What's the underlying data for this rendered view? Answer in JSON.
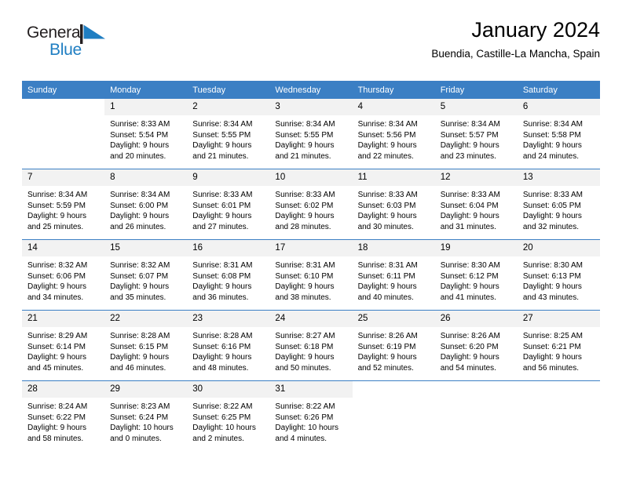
{
  "brand": {
    "name_part1": "General",
    "name_part2": "Blue",
    "flag_icon": "blue-triangle-flag-icon",
    "accent_color": "#1f7ec2"
  },
  "header": {
    "title": "January 2024",
    "subtitle": "Buendia, Castille-La Mancha, Spain"
  },
  "calendar": {
    "header_bg": "#3b7fc4",
    "daynum_bg": "#f2f2f2",
    "weekday_headers": [
      "Sunday",
      "Monday",
      "Tuesday",
      "Wednesday",
      "Thursday",
      "Friday",
      "Saturday"
    ],
    "weeks": [
      [
        {
          "day": "",
          "lines": []
        },
        {
          "day": "1",
          "lines": [
            "Sunrise: 8:33 AM",
            "Sunset: 5:54 PM",
            "Daylight: 9 hours",
            "and 20 minutes."
          ]
        },
        {
          "day": "2",
          "lines": [
            "Sunrise: 8:34 AM",
            "Sunset: 5:55 PM",
            "Daylight: 9 hours",
            "and 21 minutes."
          ]
        },
        {
          "day": "3",
          "lines": [
            "Sunrise: 8:34 AM",
            "Sunset: 5:55 PM",
            "Daylight: 9 hours",
            "and 21 minutes."
          ]
        },
        {
          "day": "4",
          "lines": [
            "Sunrise: 8:34 AM",
            "Sunset: 5:56 PM",
            "Daylight: 9 hours",
            "and 22 minutes."
          ]
        },
        {
          "day": "5",
          "lines": [
            "Sunrise: 8:34 AM",
            "Sunset: 5:57 PM",
            "Daylight: 9 hours",
            "and 23 minutes."
          ]
        },
        {
          "day": "6",
          "lines": [
            "Sunrise: 8:34 AM",
            "Sunset: 5:58 PM",
            "Daylight: 9 hours",
            "and 24 minutes."
          ]
        }
      ],
      [
        {
          "day": "7",
          "lines": [
            "Sunrise: 8:34 AM",
            "Sunset: 5:59 PM",
            "Daylight: 9 hours",
            "and 25 minutes."
          ]
        },
        {
          "day": "8",
          "lines": [
            "Sunrise: 8:34 AM",
            "Sunset: 6:00 PM",
            "Daylight: 9 hours",
            "and 26 minutes."
          ]
        },
        {
          "day": "9",
          "lines": [
            "Sunrise: 8:33 AM",
            "Sunset: 6:01 PM",
            "Daylight: 9 hours",
            "and 27 minutes."
          ]
        },
        {
          "day": "10",
          "lines": [
            "Sunrise: 8:33 AM",
            "Sunset: 6:02 PM",
            "Daylight: 9 hours",
            "and 28 minutes."
          ]
        },
        {
          "day": "11",
          "lines": [
            "Sunrise: 8:33 AM",
            "Sunset: 6:03 PM",
            "Daylight: 9 hours",
            "and 30 minutes."
          ]
        },
        {
          "day": "12",
          "lines": [
            "Sunrise: 8:33 AM",
            "Sunset: 6:04 PM",
            "Daylight: 9 hours",
            "and 31 minutes."
          ]
        },
        {
          "day": "13",
          "lines": [
            "Sunrise: 8:33 AM",
            "Sunset: 6:05 PM",
            "Daylight: 9 hours",
            "and 32 minutes."
          ]
        }
      ],
      [
        {
          "day": "14",
          "lines": [
            "Sunrise: 8:32 AM",
            "Sunset: 6:06 PM",
            "Daylight: 9 hours",
            "and 34 minutes."
          ]
        },
        {
          "day": "15",
          "lines": [
            "Sunrise: 8:32 AM",
            "Sunset: 6:07 PM",
            "Daylight: 9 hours",
            "and 35 minutes."
          ]
        },
        {
          "day": "16",
          "lines": [
            "Sunrise: 8:31 AM",
            "Sunset: 6:08 PM",
            "Daylight: 9 hours",
            "and 36 minutes."
          ]
        },
        {
          "day": "17",
          "lines": [
            "Sunrise: 8:31 AM",
            "Sunset: 6:10 PM",
            "Daylight: 9 hours",
            "and 38 minutes."
          ]
        },
        {
          "day": "18",
          "lines": [
            "Sunrise: 8:31 AM",
            "Sunset: 6:11 PM",
            "Daylight: 9 hours",
            "and 40 minutes."
          ]
        },
        {
          "day": "19",
          "lines": [
            "Sunrise: 8:30 AM",
            "Sunset: 6:12 PM",
            "Daylight: 9 hours",
            "and 41 minutes."
          ]
        },
        {
          "day": "20",
          "lines": [
            "Sunrise: 8:30 AM",
            "Sunset: 6:13 PM",
            "Daylight: 9 hours",
            "and 43 minutes."
          ]
        }
      ],
      [
        {
          "day": "21",
          "lines": [
            "Sunrise: 8:29 AM",
            "Sunset: 6:14 PM",
            "Daylight: 9 hours",
            "and 45 minutes."
          ]
        },
        {
          "day": "22",
          "lines": [
            "Sunrise: 8:28 AM",
            "Sunset: 6:15 PM",
            "Daylight: 9 hours",
            "and 46 minutes."
          ]
        },
        {
          "day": "23",
          "lines": [
            "Sunrise: 8:28 AM",
            "Sunset: 6:16 PM",
            "Daylight: 9 hours",
            "and 48 minutes."
          ]
        },
        {
          "day": "24",
          "lines": [
            "Sunrise: 8:27 AM",
            "Sunset: 6:18 PM",
            "Daylight: 9 hours",
            "and 50 minutes."
          ]
        },
        {
          "day": "25",
          "lines": [
            "Sunrise: 8:26 AM",
            "Sunset: 6:19 PM",
            "Daylight: 9 hours",
            "and 52 minutes."
          ]
        },
        {
          "day": "26",
          "lines": [
            "Sunrise: 8:26 AM",
            "Sunset: 6:20 PM",
            "Daylight: 9 hours",
            "and 54 minutes."
          ]
        },
        {
          "day": "27",
          "lines": [
            "Sunrise: 8:25 AM",
            "Sunset: 6:21 PM",
            "Daylight: 9 hours",
            "and 56 minutes."
          ]
        }
      ],
      [
        {
          "day": "28",
          "lines": [
            "Sunrise: 8:24 AM",
            "Sunset: 6:22 PM",
            "Daylight: 9 hours",
            "and 58 minutes."
          ]
        },
        {
          "day": "29",
          "lines": [
            "Sunrise: 8:23 AM",
            "Sunset: 6:24 PM",
            "Daylight: 10 hours",
            "and 0 minutes."
          ]
        },
        {
          "day": "30",
          "lines": [
            "Sunrise: 8:22 AM",
            "Sunset: 6:25 PM",
            "Daylight: 10 hours",
            "and 2 minutes."
          ]
        },
        {
          "day": "31",
          "lines": [
            "Sunrise: 8:22 AM",
            "Sunset: 6:26 PM",
            "Daylight: 10 hours",
            "and 4 minutes."
          ]
        },
        {
          "day": "",
          "lines": []
        },
        {
          "day": "",
          "lines": []
        },
        {
          "day": "",
          "lines": []
        }
      ]
    ]
  }
}
